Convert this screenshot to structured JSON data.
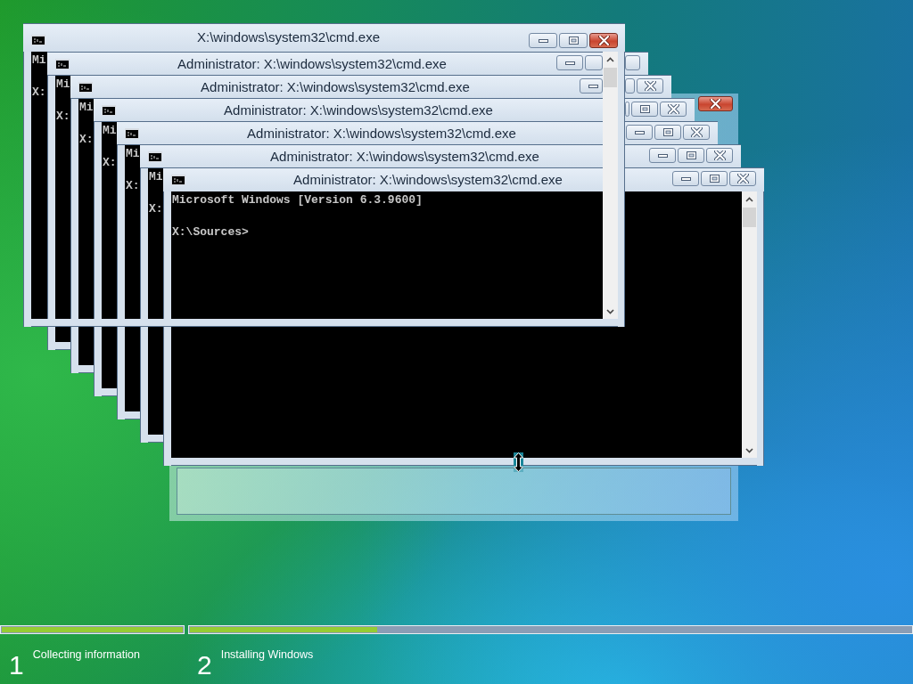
{
  "setup_window": {
    "active": true
  },
  "top_window": {
    "title": "X:\\windows\\system32\\cmd.exe",
    "active": true,
    "console_text": "Mi\n\nX:"
  },
  "stack_windows": [
    {
      "title": "Administrator: X:\\windows\\system32\\cmd.exe",
      "active": false,
      "console_text": "Mi\n\nX:"
    },
    {
      "title": "Administrator: X:\\windows\\system32\\cmd.exe",
      "active": false,
      "console_text": "Mi\n\nX:"
    },
    {
      "title": "Administrator: X:\\windows\\system32\\cmd.exe",
      "active": false,
      "console_text": "Mi\n\nX:"
    },
    {
      "title": "Administrator: X:\\windows\\system32\\cmd.exe",
      "active": false,
      "console_text": "Mi\n\nX:"
    },
    {
      "title": "Administrator: X:\\windows\\system32\\cmd.exe",
      "active": false,
      "console_text": "Mi\n\nX:"
    },
    {
      "title": "Administrator: X:\\windows\\system32\\cmd.exe",
      "active": false,
      "console_text": "Microsoft Windows [Version 6.3.9600]\n\nX:\\Sources>"
    }
  ],
  "steps": [
    {
      "number": "1",
      "label": "Collecting information",
      "level": 1
    },
    {
      "number": "2",
      "label": "Installing Windows",
      "level": 0.26
    }
  ]
}
